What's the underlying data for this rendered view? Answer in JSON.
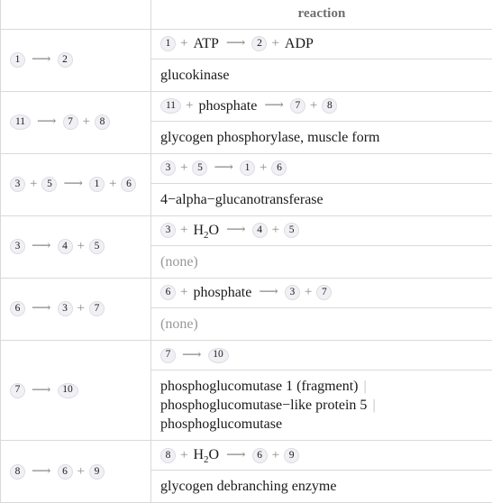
{
  "table": {
    "columns": [
      {
        "label": "",
        "name": "summary-column"
      },
      {
        "label": "reaction",
        "name": "reaction-column"
      }
    ],
    "rows": [
      {
        "summary": [
          {
            "type": "badge",
            "text": "1"
          },
          {
            "type": "arrow",
            "text": "⟶"
          },
          {
            "type": "badge",
            "text": "2"
          }
        ],
        "equation": [
          {
            "type": "badge",
            "text": "1"
          },
          {
            "type": "op",
            "text": "+"
          },
          {
            "type": "mol",
            "text": "ATP"
          },
          {
            "type": "arrow",
            "text": "⟶"
          },
          {
            "type": "badge",
            "text": "2"
          },
          {
            "type": "op",
            "text": "+"
          },
          {
            "type": "mol",
            "text": "ADP"
          }
        ],
        "enzymes": [
          "glucokinase"
        ],
        "none": false
      },
      {
        "summary": [
          {
            "type": "badge",
            "text": "11"
          },
          {
            "type": "arrow",
            "text": "⟶"
          },
          {
            "type": "badge",
            "text": "7"
          },
          {
            "type": "op",
            "text": "+"
          },
          {
            "type": "badge",
            "text": "8"
          }
        ],
        "equation": [
          {
            "type": "badge",
            "text": "11"
          },
          {
            "type": "op",
            "text": "+"
          },
          {
            "type": "mol",
            "text": "phosphate"
          },
          {
            "type": "arrow",
            "text": "⟶"
          },
          {
            "type": "badge",
            "text": "7"
          },
          {
            "type": "op",
            "text": "+"
          },
          {
            "type": "badge",
            "text": "8"
          }
        ],
        "enzymes": [
          "glycogen phosphorylase, muscle form"
        ],
        "none": false
      },
      {
        "summary": [
          {
            "type": "badge",
            "text": "3"
          },
          {
            "type": "op",
            "text": "+"
          },
          {
            "type": "badge",
            "text": "5"
          },
          {
            "type": "arrow",
            "text": "⟶"
          },
          {
            "type": "badge",
            "text": "1"
          },
          {
            "type": "op",
            "text": "+"
          },
          {
            "type": "badge",
            "text": "6"
          }
        ],
        "equation": [
          {
            "type": "badge",
            "text": "3"
          },
          {
            "type": "op",
            "text": "+"
          },
          {
            "type": "badge",
            "text": "5"
          },
          {
            "type": "arrow",
            "text": "⟶"
          },
          {
            "type": "badge",
            "text": "1"
          },
          {
            "type": "op",
            "text": "+"
          },
          {
            "type": "badge",
            "text": "6"
          }
        ],
        "enzymes": [
          "4−alpha−glucanotransferase"
        ],
        "none": false
      },
      {
        "summary": [
          {
            "type": "badge",
            "text": "3"
          },
          {
            "type": "arrow",
            "text": "⟶"
          },
          {
            "type": "badge",
            "text": "4"
          },
          {
            "type": "op",
            "text": "+"
          },
          {
            "type": "badge",
            "text": "5"
          }
        ],
        "equation": [
          {
            "type": "badge",
            "text": "3"
          },
          {
            "type": "op",
            "text": "+"
          },
          {
            "type": "mol",
            "text": "H2O",
            "sub": {
              "base": "H",
              "sub": "2",
              "tail": "O"
            }
          },
          {
            "type": "arrow",
            "text": "⟶"
          },
          {
            "type": "badge",
            "text": "4"
          },
          {
            "type": "op",
            "text": "+"
          },
          {
            "type": "badge",
            "text": "5"
          }
        ],
        "enzymes": [
          "(none)"
        ],
        "none": true
      },
      {
        "summary": [
          {
            "type": "badge",
            "text": "6"
          },
          {
            "type": "arrow",
            "text": "⟶"
          },
          {
            "type": "badge",
            "text": "3"
          },
          {
            "type": "op",
            "text": "+"
          },
          {
            "type": "badge",
            "text": "7"
          }
        ],
        "equation": [
          {
            "type": "badge",
            "text": "6"
          },
          {
            "type": "op",
            "text": "+"
          },
          {
            "type": "mol",
            "text": "phosphate"
          },
          {
            "type": "arrow",
            "text": "⟶"
          },
          {
            "type": "badge",
            "text": "3"
          },
          {
            "type": "op",
            "text": "+"
          },
          {
            "type": "badge",
            "text": "7"
          }
        ],
        "enzymes": [
          "(none)"
        ],
        "none": true
      },
      {
        "summary": [
          {
            "type": "badge",
            "text": "7"
          },
          {
            "type": "arrow",
            "text": "⟶"
          },
          {
            "type": "badge",
            "text": "10"
          }
        ],
        "equation": [
          {
            "type": "badge",
            "text": "7"
          },
          {
            "type": "arrow",
            "text": "⟶"
          },
          {
            "type": "badge",
            "text": "10"
          }
        ],
        "enzymes": [
          "phosphoglucomutase 1 (fragment)",
          "phosphoglucomutase−like protein 5",
          "phosphoglucomutase"
        ],
        "none": false
      },
      {
        "summary": [
          {
            "type": "badge",
            "text": "8"
          },
          {
            "type": "arrow",
            "text": "⟶"
          },
          {
            "type": "badge",
            "text": "6"
          },
          {
            "type": "op",
            "text": "+"
          },
          {
            "type": "badge",
            "text": "9"
          }
        ],
        "equation": [
          {
            "type": "badge",
            "text": "8"
          },
          {
            "type": "op",
            "text": "+"
          },
          {
            "type": "mol",
            "text": "H2O",
            "sub": {
              "base": "H",
              "sub": "2",
              "tail": "O"
            }
          },
          {
            "type": "arrow",
            "text": "⟶"
          },
          {
            "type": "badge",
            "text": "6"
          },
          {
            "type": "op",
            "text": "+"
          },
          {
            "type": "badge",
            "text": "9"
          }
        ],
        "enzymes": [
          "glycogen debranching enzyme"
        ],
        "none": false
      }
    ]
  },
  "style": {
    "badge_fill": "#f1f1f5",
    "badge_border": "#dcdce2",
    "grid_line": "#d9d9d9",
    "operator_color": "#8a8a8a",
    "muted_text": "#999999",
    "text_color": "#1a1a1a"
  }
}
